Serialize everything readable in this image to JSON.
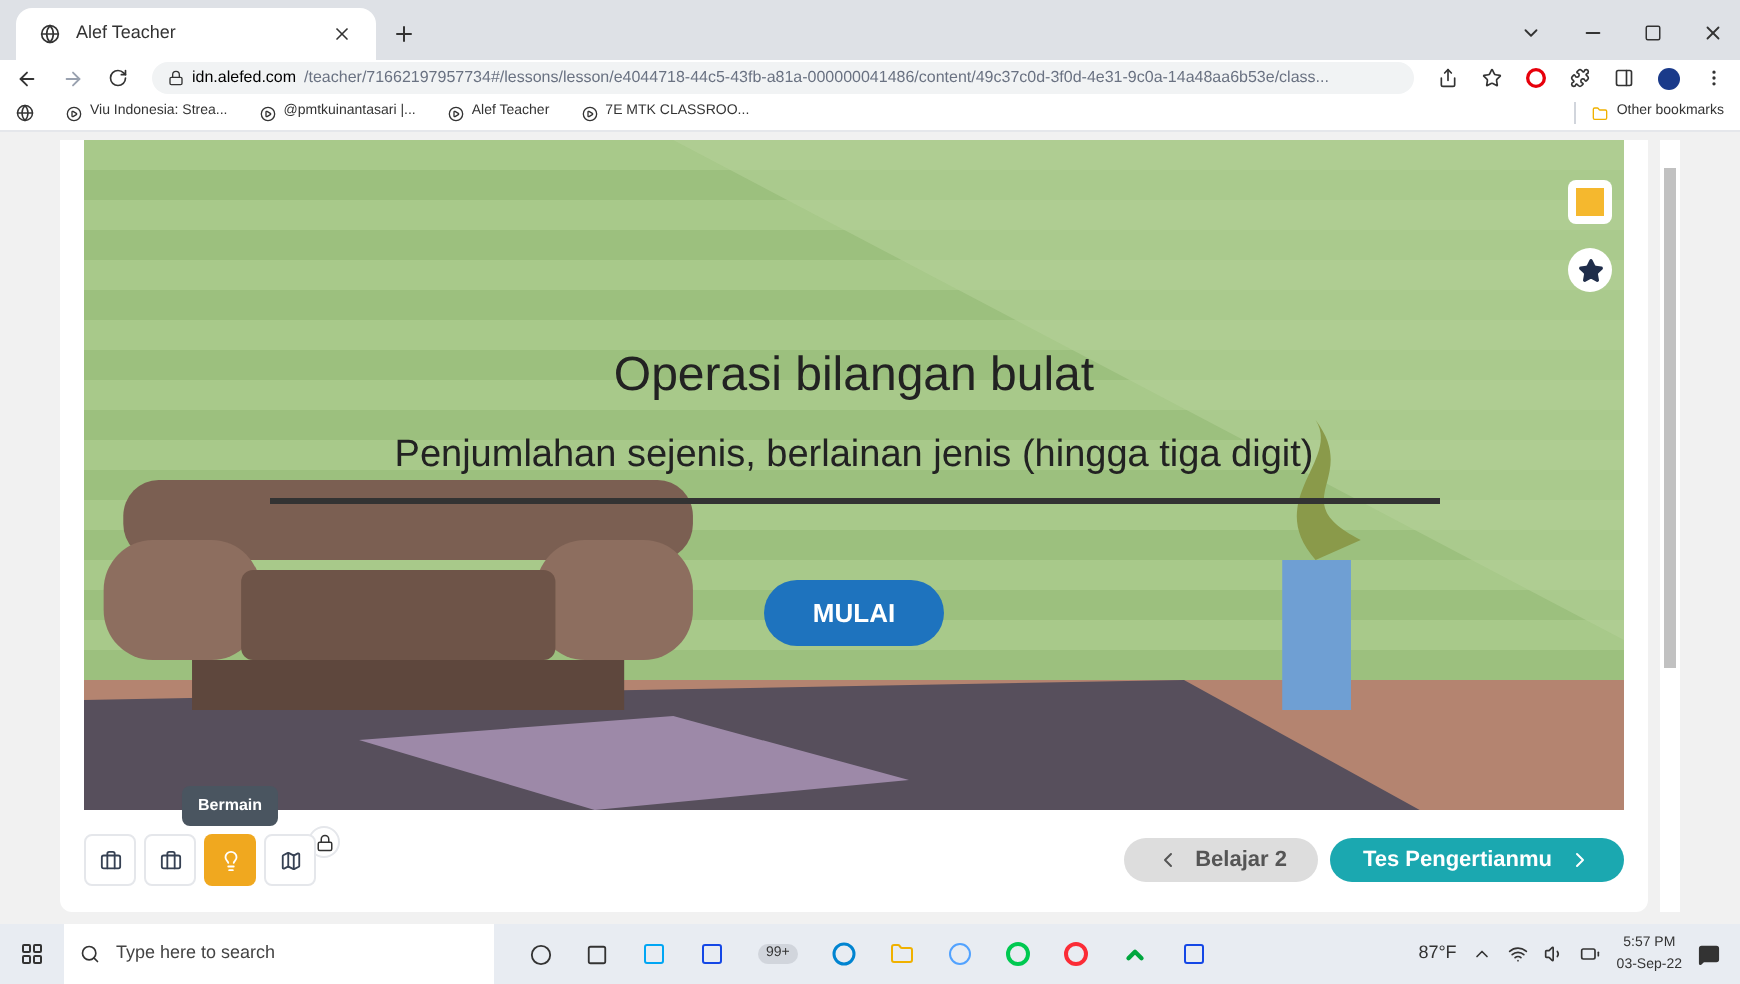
{
  "browser": {
    "tabs": [
      {
        "title": "Alef Teacher",
        "selected": true
      }
    ],
    "url_host": "idn.alefed.com",
    "url_path": "/teacher/71662197957734#/lessons/lesson/e4044718-44c5-43fb-a81a-000000041486/content/49c37c0d-3f0d-4e31-9c0a-14a48aa6b53e/class...",
    "bookmarks": [
      {
        "label": "Viu Indonesia: Strea..."
      },
      {
        "label": "@pmtkuinantasari |..."
      },
      {
        "label": "Alef Teacher"
      },
      {
        "label": "7E MTK CLASSROO..."
      }
    ],
    "other_bookmarks": "Other bookmarks"
  },
  "lesson": {
    "title": "Operasi bilangan bulat",
    "subtitle": "Penjumlahan sejenis, berlainan jenis (hingga tiga digit)",
    "start_button": "MULAI"
  },
  "steps": [
    {
      "selected": false
    },
    {
      "selected": false
    },
    {
      "selected": true,
      "tooltip": "Bermain"
    },
    {
      "selected": false
    }
  ],
  "prev_button": "Belajar 2",
  "next_button": "Tes Pengertianmu",
  "taskbar": {
    "search_placeholder": "Type here to search",
    "badge": "99+",
    "weather": "87°F",
    "time": "5:57 PM",
    "date": "03-Sep-22"
  }
}
